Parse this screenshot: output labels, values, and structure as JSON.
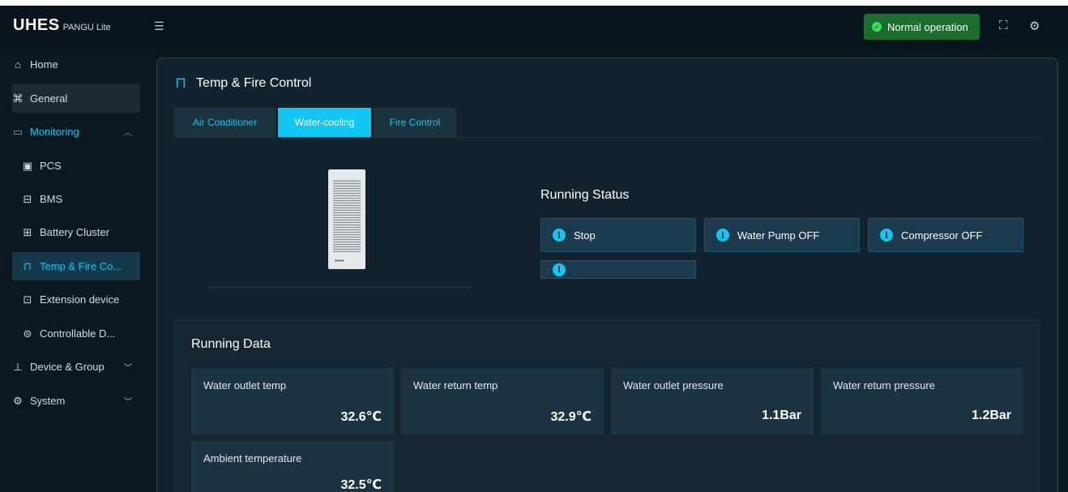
{
  "app": {
    "brand": "UHES",
    "product": "PANGU Lite"
  },
  "topbar": {
    "status": "Normal operation"
  },
  "sidebar": {
    "items": [
      {
        "label": "Home"
      },
      {
        "label": "General"
      },
      {
        "label": "Monitoring"
      },
      {
        "label": "PCS"
      },
      {
        "label": "BMS"
      },
      {
        "label": "Battery Cluster"
      },
      {
        "label": "Temp & Fire Co..."
      },
      {
        "label": "Extension device"
      },
      {
        "label": "Controllable D..."
      },
      {
        "label": "Device & Group"
      },
      {
        "label": "System"
      }
    ]
  },
  "main": {
    "title": "Temp & Fire Control",
    "tabs": [
      {
        "label": "Air Conditioner"
      },
      {
        "label": "Water-cooling"
      },
      {
        "label": "Fire Control"
      }
    ],
    "active_tab": "Water-cooling"
  },
  "running_status": {
    "title": "Running Status",
    "items": [
      {
        "label": "Stop"
      },
      {
        "label": "Water Pump OFF"
      },
      {
        "label": "Compressor OFF"
      },
      {
        "label": ""
      }
    ]
  },
  "running_data": {
    "title": "Running Data",
    "cards": [
      {
        "label": "Water outlet temp",
        "value": "32.6℃"
      },
      {
        "label": "Water return temp",
        "value": "32.9℃"
      },
      {
        "label": "Water outlet pressure",
        "value": "1.1Bar"
      },
      {
        "label": "Water return pressure",
        "value": "1.2Bar"
      },
      {
        "label": "Ambient temperature",
        "value": "32.5℃"
      }
    ]
  },
  "colors": {
    "accent": "#12c8f2",
    "status_ok": "#1d6e2e",
    "background": "#0b1820"
  }
}
